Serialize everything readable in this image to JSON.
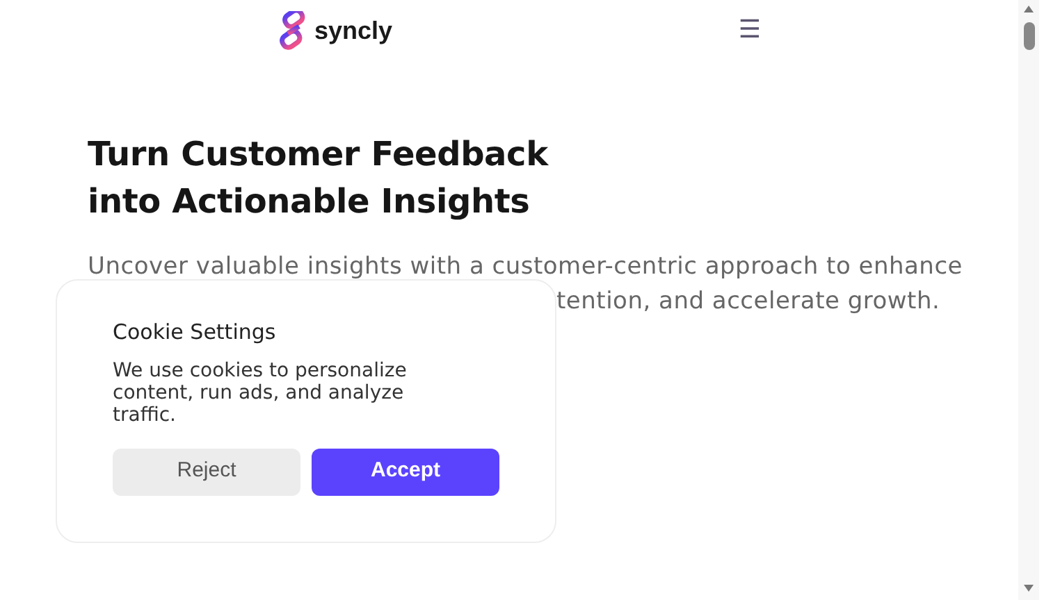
{
  "header": {
    "brand": "syncly",
    "menu_icon": "☰"
  },
  "hero": {
    "title_lines": [
      "Turn Customer Feedback",
      "into Actionable Insights"
    ],
    "paragraph_lines": [
      "Uncover valuable insights with a customer-centric approach to enhance",
      "tention, and accelerate growth."
    ]
  },
  "cookie_banner": {
    "title": "Cookie Settings",
    "text": "We use cookies to personalize content, run ads, and analyze traffic.",
    "buttons": [
      {
        "label": "Reject",
        "kind": "secondary"
      },
      {
        "label": "Accept",
        "kind": "primary"
      }
    ]
  }
}
